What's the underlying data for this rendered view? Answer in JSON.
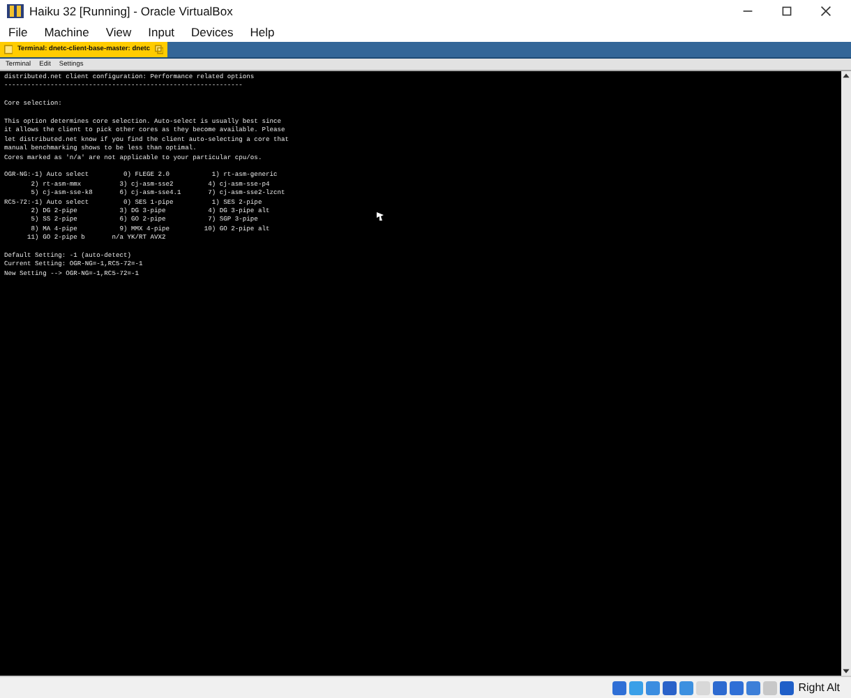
{
  "window": {
    "title": "Haiku 32 [Running] - Oracle VirtualBox"
  },
  "menu": [
    "File",
    "Machine",
    "View",
    "Input",
    "Devices",
    "Help"
  ],
  "guest_tab": {
    "title": "Terminal: dnetc-client-base-master: dnetc"
  },
  "terminal_menu": [
    "Terminal",
    "Edit",
    "Settings"
  ],
  "terminal": {
    "blocks": [
      [
        "distributed.net client configuration: Performance related options",
        "--------------------------------------------------------------"
      ],
      [
        "Core selection:"
      ],
      [
        "This option determines core selection. Auto-select is usually best since",
        "it allows the client to pick other cores as they become available. Please",
        "let distributed.net know if you find the client auto-selecting a core that",
        "manual benchmarking shows to be less than optimal.",
        "Cores marked as 'n/a' are not applicable to your particular cpu/os."
      ],
      [
        "OGR-NG:-1) Auto select         0) FLEGE 2.0           1) rt-asm-generic",
        "       2) rt-asm-mmx          3) cj-asm-sse2         4) cj-asm-sse-p4",
        "       5) cj-asm-sse-k8       6) cj-asm-sse4.1       7) cj-asm-sse2-lzcnt",
        "RC5-72:-1) Auto select         0) SES 1-pipe          1) SES 2-pipe",
        "       2) DG 2-pipe           3) DG 3-pipe           4) DG 3-pipe alt",
        "       5) SS 2-pipe           6) GO 2-pipe           7) SGP 3-pipe",
        "       8) MA 4-pipe           9) MMX 4-pipe         10) GO 2-pipe alt",
        "      11) GO 2-pipe b       n/a YK/RT AVX2"
      ],
      [
        "Default Setting: -1 (auto-detect)",
        "Current Setting: OGR-NG=-1,RC5-72=-1",
        "New Setting --> OGR-NG=-1,RC5-72=-1"
      ]
    ]
  },
  "status_bar": {
    "host_key": "Right Alt"
  }
}
